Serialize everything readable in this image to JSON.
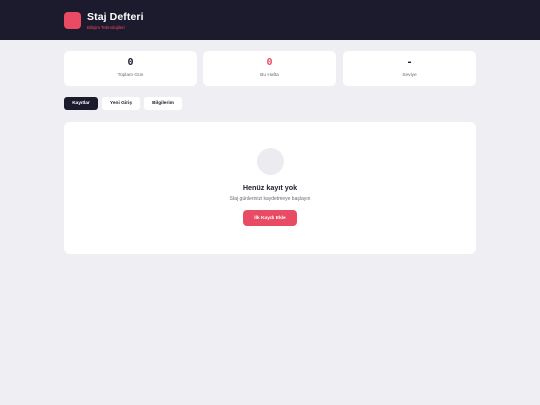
{
  "header": {
    "title": "Staj Defteri",
    "subtitle": "Bilişim Teknolojileri"
  },
  "stats": [
    {
      "value": "0",
      "label": "Toplam Gün"
    },
    {
      "value": "0",
      "label": "Bu Hafta"
    },
    {
      "value": "-",
      "label": "Seviye"
    }
  ],
  "tabs": [
    {
      "label": "Kayıtlar",
      "active": true
    },
    {
      "label": "Yeni Giriş",
      "active": false
    },
    {
      "label": "Bilgilerim",
      "active": false
    }
  ],
  "empty_state": {
    "title": "Henüz kayıt yok",
    "description": "Staj günlerinizi kaydetmeye başlayın",
    "button_label": "İlk Kaydı Ekle"
  },
  "colors": {
    "header_bg": "#1c1b2d",
    "accent": "#e94b64",
    "page_bg": "#efeef3"
  }
}
